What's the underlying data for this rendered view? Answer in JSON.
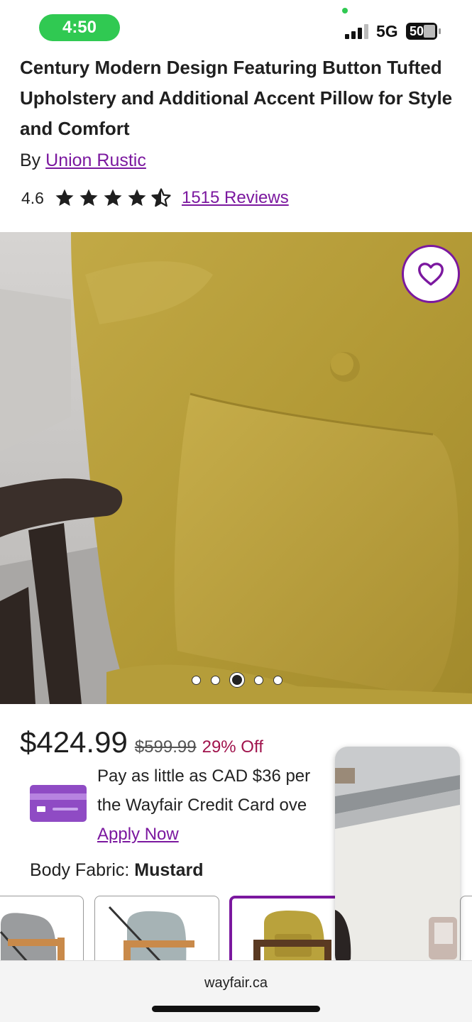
{
  "status_bar": {
    "time": "4:50",
    "network": "5G",
    "battery": "50"
  },
  "product": {
    "title": "Century Modern Design Featuring Button Tufted Upholstery and Additional Accent Pillow for Style and Comfort",
    "by_prefix": "By",
    "brand": "Union Rustic",
    "rating": "4.6",
    "rating_value": 4.6,
    "reviews_label": "1515 Reviews",
    "image_dots": {
      "count": 5,
      "active_index": 2
    }
  },
  "pricing": {
    "price": "$424.99",
    "old_price": "$599.99",
    "discount": "29% Off"
  },
  "credit": {
    "line1": "Pay as little as CAD $36 per",
    "line2": "the Wayfair Credit Card ove",
    "apply_label": "Apply Now"
  },
  "options": {
    "fabric_label": "Body Fabric:",
    "fabric_value": "Mustard"
  },
  "browser": {
    "url": "wayfair.ca"
  },
  "colors": {
    "brand_purple": "#7b189f",
    "discount_red": "#a0134c",
    "mustard": "#b9a23c"
  },
  "icons": [
    "heart-icon",
    "star-icon",
    "star-half-icon",
    "credit-card-icon"
  ]
}
